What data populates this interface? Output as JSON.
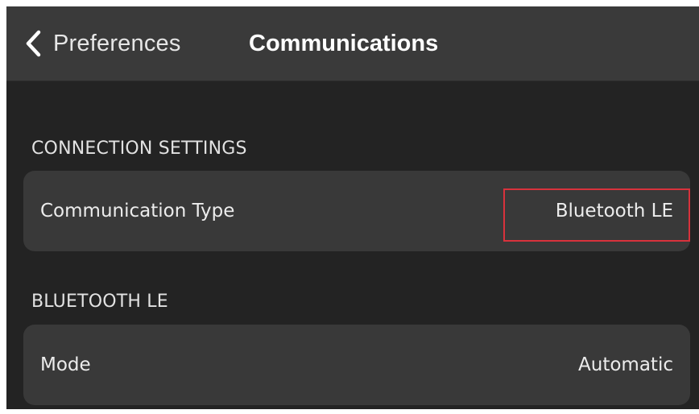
{
  "header": {
    "back_label": "Preferences",
    "title": "Communications"
  },
  "sections": [
    {
      "title": "CONNECTION SETTINGS",
      "rows": [
        {
          "label": "Communication Type",
          "value": "Bluetooth LE"
        }
      ]
    },
    {
      "title": "BLUETOOTH LE",
      "rows": [
        {
          "label": "Mode",
          "value": "Automatic"
        }
      ]
    }
  ],
  "colors": {
    "background": "#232323",
    "header": "#3a3a3a",
    "row": "#393939",
    "highlight": "#d8323c"
  },
  "icons": {
    "back": "chevron-left-icon"
  }
}
